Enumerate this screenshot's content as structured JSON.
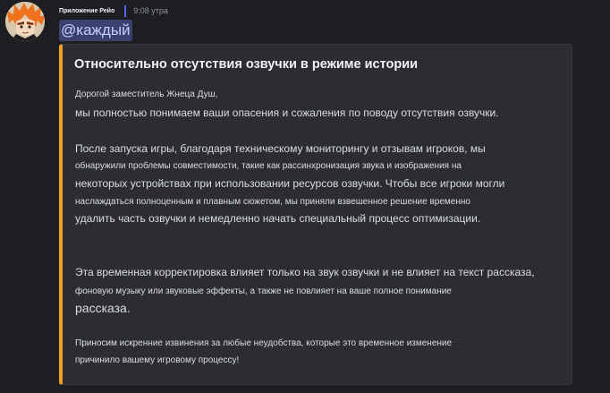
{
  "author": {
    "name": "Приложение Рейо",
    "timestamp": "9:08 утра",
    "avatar_icon": "anime-avatar-icon"
  },
  "mention": "@каждый",
  "embed": {
    "accent_color": "#f0a020",
    "title": "Относительно отсутствия озвучки в режиме истории",
    "lines": [
      "Дорогой заместитель Жнеца Душ,",
      "мы полностью понимаем ваши опасения и сожаления по поводу отсутствия озвучки.",
      "После запуска игры, благодаря техническому мониторингу и отзывам игроков, мы",
      "обнаружили проблемы совместимости, такие как рассинхронизация звука и изображения на",
      "некоторых устройствах при использовании ресурсов озвучки. Чтобы все игроки могли",
      "наслаждаться полноценным и плавным сюжетом, мы приняли взвешенное решение временно",
      "удалить часть озвучки и немедленно начать специальный процесс оптимизации.",
      "Эта временная корректировка влияет только на звук озвучки и не влияет на текст рассказа,",
      "фоновую музыку или звуковые эффекты, а также не повлияет на ваше полное понимание",
      "рассказа.",
      "Приносим искренние извинения за любые неудобства, которые это временное изменение",
      "причинило вашему игровому процессу!"
    ]
  }
}
